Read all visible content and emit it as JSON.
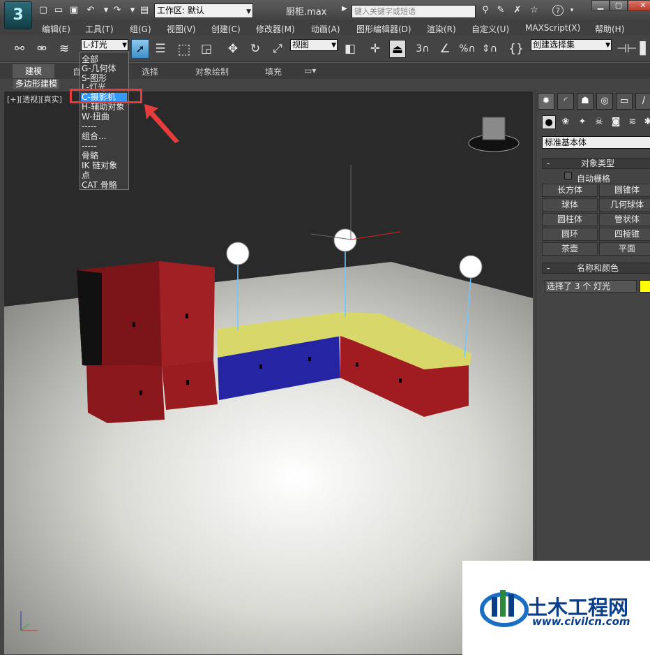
{
  "window": {
    "title": "厨柜.max",
    "workspace_label": "工作区: 默认",
    "search_placeholder": "键入关键字或短语"
  },
  "menu": [
    "编辑(E)",
    "工具(T)",
    "组(G)",
    "视图(V)",
    "创建(C)",
    "修改器(M)",
    "动画(A)",
    "图形编辑器(D)",
    "渲染(R)",
    "自定义(U)",
    "MAXScript(X)",
    "帮助(H)"
  ],
  "toolbar": {
    "selection_filter": "L-灯光",
    "reference_coord": "视图",
    "named_selection": "创建选择集",
    "snap_label": "3"
  },
  "ribbon": {
    "tabs": [
      "建模",
      "自",
      "选择",
      "对象绘制",
      "填充"
    ],
    "sub_label": "多边形建模"
  },
  "viewport": {
    "label": "[+][透视][真实]"
  },
  "filter_dropdown": {
    "items": [
      "全部",
      "G-几何体",
      "S-图形",
      "L-灯光",
      "C-摄影机",
      "H-辅助对象",
      "W-扭曲",
      "-----",
      "组合...",
      "-----",
      "骨骼",
      "IK 链对象",
      "点",
      "CAT 骨骼"
    ],
    "highlighted": "C-摄影机"
  },
  "command_panel": {
    "primitive_type": "标准基本体",
    "object_type_title": "对象类型",
    "autogrid": "自动栅格",
    "buttons": [
      "长方体",
      "圆锥体",
      "球体",
      "几何球体",
      "圆柱体",
      "管状体",
      "圆环",
      "四棱锥",
      "茶壶",
      "平面"
    ],
    "name_color_title": "名称和颜色",
    "name_value": "选择了 3 个 灯光",
    "object_color": "#ffff00"
  },
  "watermark": {
    "text": "土木工程网",
    "url": "www.civilcn.com"
  },
  "colors": {
    "accent_red": "#e83c3c",
    "selected_blue": "#3399ff",
    "cabinet_red": "#a01c20",
    "cabinet_blue": "#2424a0",
    "countertop_yellow": "#d8d86a"
  }
}
